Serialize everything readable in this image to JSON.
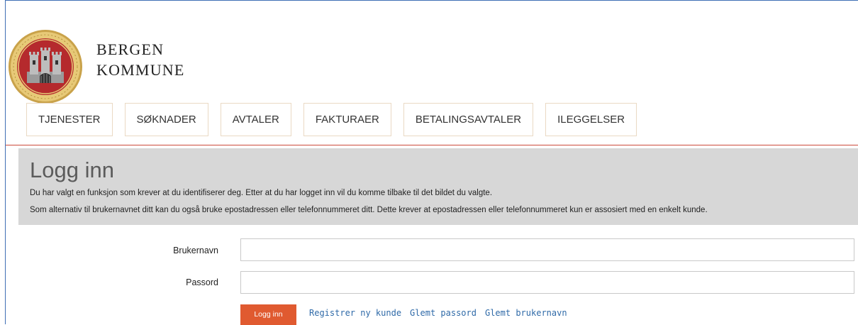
{
  "brand": {
    "line1": "BERGEN",
    "line2": "KOMMUNE"
  },
  "nav": {
    "tabs": [
      {
        "label": "TJENESTER"
      },
      {
        "label": "SØKNADER"
      },
      {
        "label": "AVTALER"
      },
      {
        "label": "FAKTURAER"
      },
      {
        "label": "BETALINGSAVTALER"
      },
      {
        "label": "ILEGGELSER"
      }
    ]
  },
  "login": {
    "title": "Logg inn",
    "description_1": "Du har valgt en funksjon som krever at du identifiserer deg. Etter at du har logget inn vil du komme tilbake til det bildet du valgte.",
    "description_2": "Som alternativ til brukernavnet ditt kan du også bruke epostadressen eller telefonnummeret ditt. Dette krever at epostadressen eller telefonnummeret kun er assosiert med en enkelt kunde.",
    "username_label": "Brukernavn",
    "username_value": "",
    "password_label": "Passord",
    "password_value": "",
    "submit_label": "Logg inn",
    "links": {
      "register": "Registrer ny kunde",
      "forgot_password": "Glemt passord",
      "forgot_username": "Glemt brukernavn"
    }
  },
  "colors": {
    "accent": "#e05a30",
    "link": "#2f6aa8",
    "nav_rule": "#cc4a3a",
    "panel_bg": "#d7d7d7",
    "seal_red": "#b52a2d",
    "seal_gold": "#d9b25a"
  },
  "icons": {
    "logo": "bergen-kommune-seal-icon"
  }
}
